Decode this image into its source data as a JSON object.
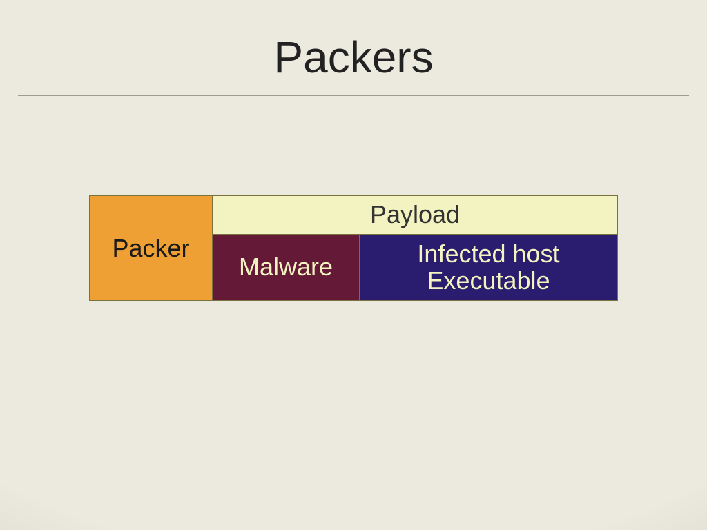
{
  "title": "Packers",
  "diagram": {
    "packer": "Packer",
    "payload_header": "Payload",
    "malware": "Malware",
    "infected_host": "Infected host\nExecutable"
  },
  "colors": {
    "packer_bg": "#eea034",
    "payload_header_bg": "#f3f3c1",
    "malware_bg": "#641a37",
    "infected_bg": "#2a1c6e",
    "light_text": "#f3f3c1"
  }
}
